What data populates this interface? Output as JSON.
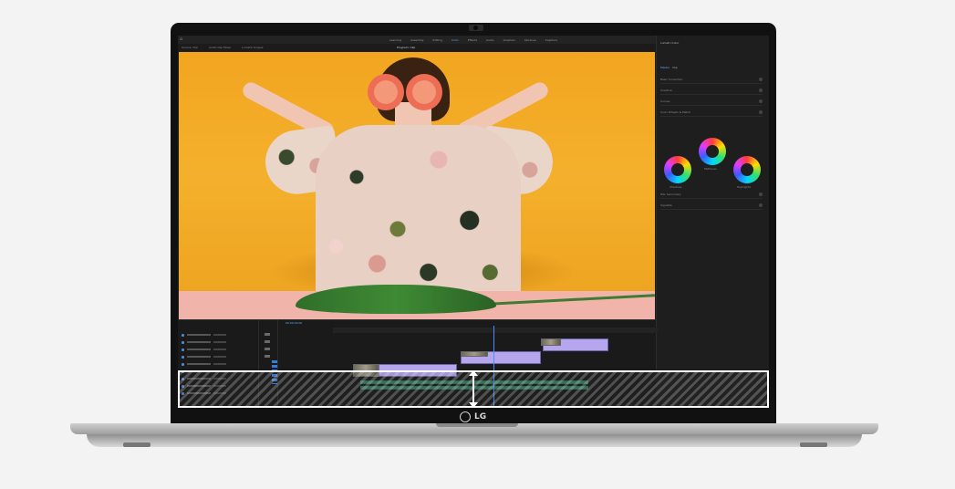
{
  "device": {
    "brand_label": "LG"
  },
  "app": {
    "menu_tabs": [
      "Learning",
      "Assembly",
      "Editing",
      "Color",
      "Effects",
      "Audio",
      "Graphics",
      "Libraries",
      "Captions"
    ],
    "active_tab": "Color",
    "subbar_items": [
      "Source: Clip",
      "Audio Clip Mixer",
      "Lumetri Scopes"
    ],
    "program_title": "Program: Clip"
  },
  "lumetri": {
    "panel_title": "Lumetri Color",
    "tabs": [
      "Master",
      "Clip"
    ],
    "sections": [
      "Basic Correction",
      "Creative",
      "Curves",
      "Color Wheels & Match",
      "HSL Secondary",
      "Vignette"
    ],
    "wheel_labels": [
      "Midtones",
      "Shadows",
      "Highlights"
    ]
  },
  "timeline": {
    "sequence_label": "00:00:00:00"
  },
  "colors": {
    "accent": "#6aa7ff",
    "video_clip": "#b6a6ee",
    "audio_clip": "#2f7c5d",
    "photo_background": "#f2a520"
  },
  "icons": {
    "resize_arrow": "vertical-double-arrow-icon",
    "home": "home-icon",
    "logo": "lg-logo-icon"
  }
}
